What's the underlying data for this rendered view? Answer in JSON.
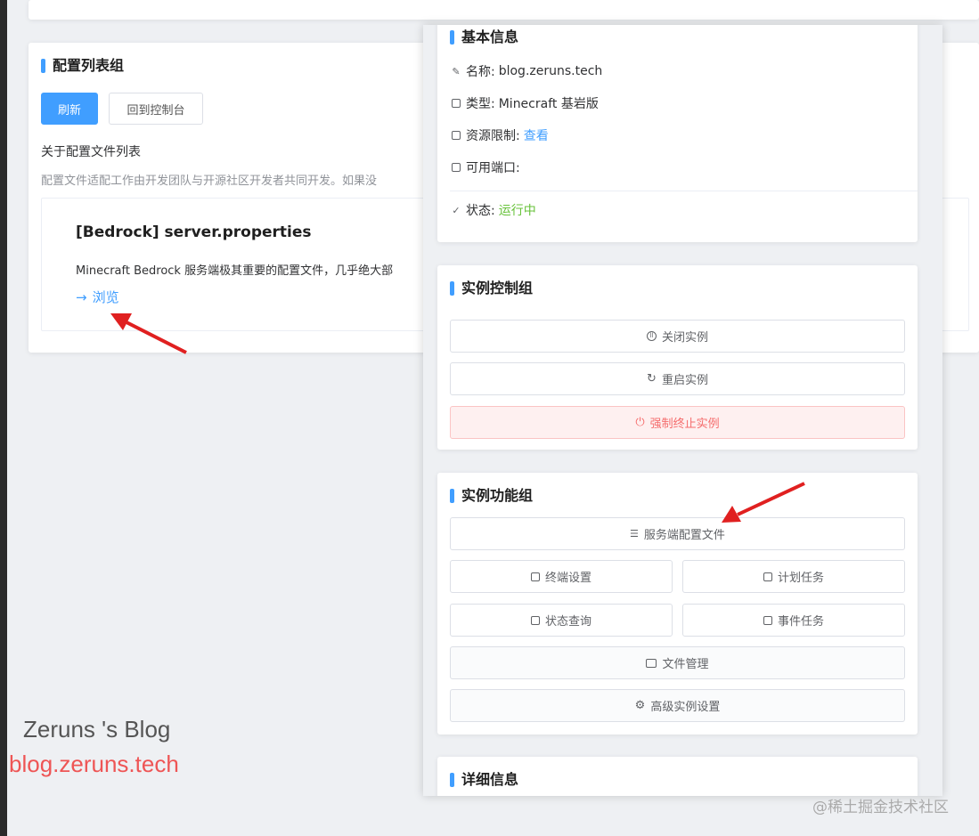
{
  "config_group": {
    "title": "配置列表组",
    "refresh_label": "刷新",
    "back_label": "回到控制台",
    "about_title": "关于配置文件列表",
    "about_desc": "配置文件适配工作由开发团队与开源社区开发者共同开发。如果没",
    "file_card": {
      "title": "[Bedrock] server.properties",
      "desc": "Minecraft Bedrock 服务端极其重要的配置文件，几乎绝大部",
      "browse_label": "浏览"
    }
  },
  "basic_info": {
    "title": "基本信息",
    "name_label": "名称: ",
    "name_value": "blog.zeruns.tech",
    "type_label": "类型: ",
    "type_value": "Minecraft 基岩版",
    "resource_label": "资源限制: ",
    "resource_link": "查看",
    "ports_label": "可用端口:",
    "status_label": "状态: ",
    "status_value": "运行中"
  },
  "control_group": {
    "title": "实例控制组",
    "stop_label": "关闭实例",
    "restart_label": "重启实例",
    "kill_label": "强制终止实例"
  },
  "function_group": {
    "title": "实例功能组",
    "server_config_label": "服务端配置文件",
    "terminal_label": "终端设置",
    "schedule_label": "计划任务",
    "status_query_label": "状态查询",
    "event_label": "事件任务",
    "file_manager_label": "文件管理",
    "advanced_label": "高级实例设置"
  },
  "detail_group": {
    "title": "详细信息"
  },
  "watermarks": {
    "blog_name": "Zeruns 's Blog",
    "blog_url": "blog.zeruns.tech",
    "site": "@稀土掘金技术社区"
  },
  "colors": {
    "accent": "#409eff",
    "success": "#67c23a",
    "danger": "#f56c6c",
    "annotation_arrow": "#e02020"
  }
}
